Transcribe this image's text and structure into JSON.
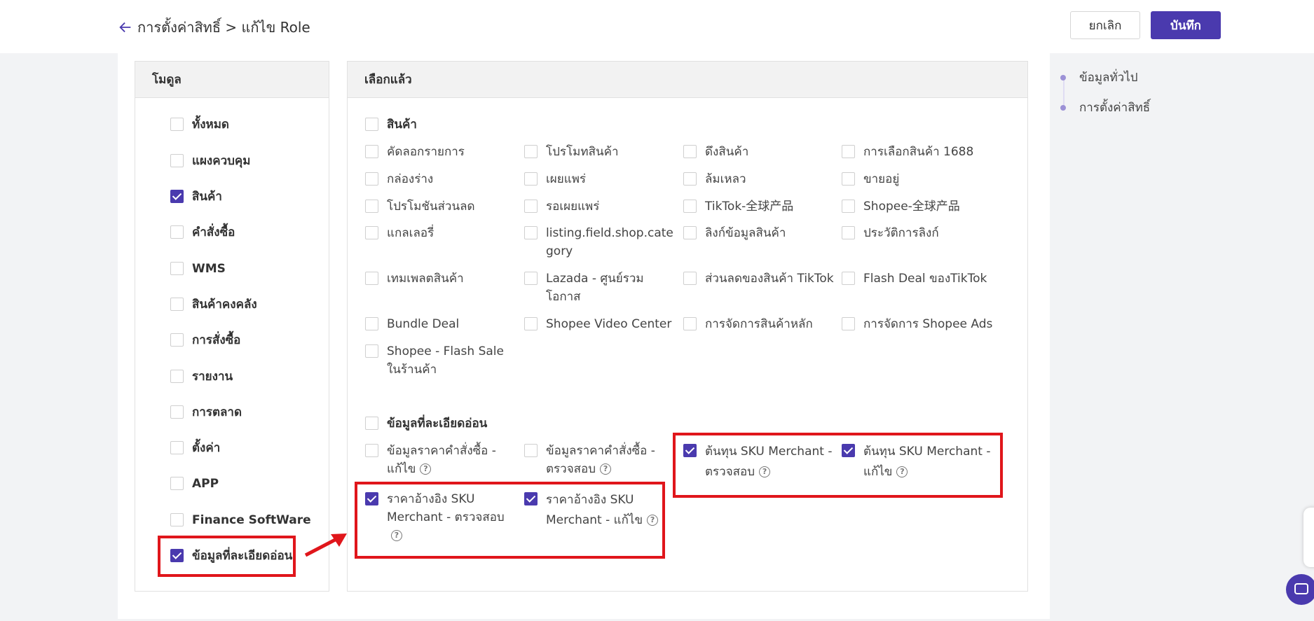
{
  "header": {
    "breadcrumb": "การตั้งค่าสิทธิ์ > แก้ไข Role",
    "cancel_label": "ยกเลิก",
    "save_label": "บันทึก"
  },
  "left_panel": {
    "title": "โมดูล",
    "items": [
      {
        "label": "ทั้งหมด",
        "checked": false
      },
      {
        "label": "แผงควบคุม",
        "checked": false
      },
      {
        "label": "สินค้า",
        "checked": true
      },
      {
        "label": "คำสั่งซื้อ",
        "checked": false
      },
      {
        "label": "WMS",
        "checked": false
      },
      {
        "label": "สินค้าคงคลัง",
        "checked": false
      },
      {
        "label": "การสั่งซื้อ",
        "checked": false
      },
      {
        "label": "รายงาน",
        "checked": false
      },
      {
        "label": "การตลาด",
        "checked": false
      },
      {
        "label": "ตั้งค่า",
        "checked": false
      },
      {
        "label": "APP",
        "checked": false
      },
      {
        "label": "Finance SoftWare",
        "checked": false
      },
      {
        "label": "ข้อมูลที่ละเอียดอ่อน",
        "checked": true
      }
    ]
  },
  "right_panel": {
    "title": "เลือกแล้ว",
    "products": {
      "header": "สินค้า",
      "items": [
        "คัดลอกรายการ",
        "โปรโมทสินค้า",
        "ดึงสินค้า",
        "การเลือกสินค้า 1688",
        "กล่องร่าง",
        "เผยแพร่",
        "ล้มเหลว",
        "ขายอยู่",
        "โปรโมชันส่วนลด",
        "รอเผยแพร่",
        "TikTok-全球产品",
        "Shopee-全球产品",
        "แกลเลอรี่",
        "listing.field.shop.category",
        "ลิงก์ข้อมูลสินค้า",
        "ประวัติการลิงก์",
        "เทมเพลตสินค้า",
        "Lazada - ศูนย์รวมโอกาส",
        "ส่วนลดของสินค้า TikTok",
        "Flash Deal ของTikTok",
        "Bundle Deal",
        "Shopee Video Center",
        "การจัดการสินค้าหลัก",
        "การจัดการ Shopee Ads",
        "Shopee - Flash Sale ในร้านค้า"
      ]
    },
    "sensitive": {
      "header": "ข้อมูลที่ละเอียดอ่อน",
      "items": [
        {
          "label": "ข้อมูลราคาคำสั่งซื้อ - แก้ไข",
          "checked": false
        },
        {
          "label": "ข้อมูลราคาคำสั่งซื้อ - ตรวจสอบ",
          "checked": false
        },
        {
          "label": "ต้นทุน SKU Merchant - ตรวจสอบ",
          "checked": true
        },
        {
          "label": "ต้นทุน SKU Merchant - แก้ไข",
          "checked": true
        },
        {
          "label": "ราคาอ้างอิง SKU Merchant - ตรวจสอบ",
          "checked": true
        },
        {
          "label": "ราคาอ้างอิง SKU Merchant - แก้ไข",
          "checked": true
        }
      ]
    }
  },
  "side_nav": {
    "items": [
      "ข้อมูลทั่วไป",
      "การตั้งค่าสิทธิ์"
    ]
  },
  "colors": {
    "accent": "#4a3aae",
    "annotation": "#e0161b"
  },
  "icons": {
    "back": "arrow-left-icon",
    "help": "question-circle-icon",
    "chat": "chat-icon"
  }
}
